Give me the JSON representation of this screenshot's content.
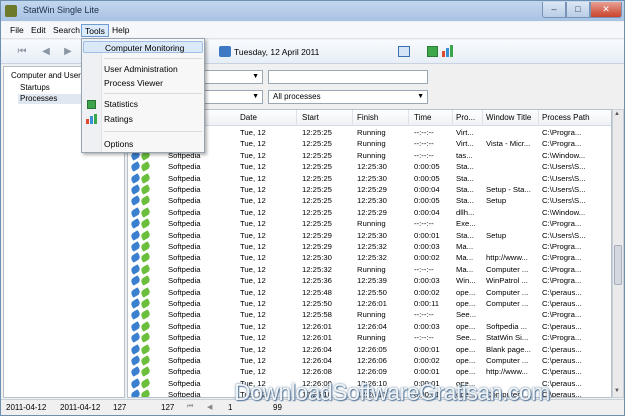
{
  "window": {
    "title": "StatWin Single Lite"
  },
  "menubar": {
    "items": [
      "File",
      "Edit",
      "Search",
      "Tools",
      "Help"
    ]
  },
  "toolbar": {
    "date": "Tuesday, 12 April 2011"
  },
  "tools_menu": {
    "items": [
      "Computer Monitoring",
      "User Administration",
      "Process Viewer",
      "Statistics",
      "Ratings",
      "Options"
    ]
  },
  "tree": {
    "items": [
      "Computer and Users",
      "Startups",
      "Processes"
    ]
  },
  "filters": {
    "process_filter": "All processes"
  },
  "grid": {
    "columns": [
      "Date",
      "Start",
      "Finish",
      "Time",
      "Pro...",
      "Window Title",
      "Process Path"
    ],
    "rows": [
      [
        "",
        "Tue, 12",
        "12:25:25",
        "Running",
        "--:--:--",
        "Virt...",
        "",
        "C:\\Progra..."
      ],
      [
        "",
        "Tue, 12",
        "12:25:25",
        "Running",
        "--:--:--",
        "Virt...",
        "Vista - Micr...",
        "C:\\Progra..."
      ],
      [
        "Softpedia",
        "Tue, 12",
        "12:25:25",
        "Running",
        "--:--:--",
        "tas...",
        "",
        "C:\\Window..."
      ],
      [
        "Softpedia",
        "Tue, 12",
        "12:25:25",
        "12:25:30",
        "0:00:05",
        "Sta...",
        "",
        "C:\\Users\\S..."
      ],
      [
        "Softpedia",
        "Tue, 12",
        "12:25:25",
        "12:25:30",
        "0:00:05",
        "Sta...",
        "",
        "C:\\Users\\S..."
      ],
      [
        "Softpedia",
        "Tue, 12",
        "12:25:25",
        "12:25:29",
        "0:00:04",
        "Sta...",
        "Setup - Sta...",
        "C:\\Users\\S..."
      ],
      [
        "Softpedia",
        "Tue, 12",
        "12:25:25",
        "12:25:30",
        "0:00:05",
        "Sta...",
        "Setup",
        "C:\\Users\\S..."
      ],
      [
        "Softpedia",
        "Tue, 12",
        "12:25:25",
        "12:25:29",
        "0:00:04",
        "dllh...",
        "",
        "C:\\Window..."
      ],
      [
        "Softpedia",
        "Tue, 12",
        "12:25:25",
        "Running",
        "--:--:--",
        "Exe...",
        "",
        "C:\\Progra..."
      ],
      [
        "Softpedia",
        "Tue, 12",
        "12:25:29",
        "12:25:30",
        "0:00:01",
        "Sta...",
        "Setup",
        "C:\\Users\\S..."
      ],
      [
        "Softpedia",
        "Tue, 12",
        "12:25:29",
        "12:25:32",
        "0:00:03",
        "Ma...",
        "",
        "C:\\Progra..."
      ],
      [
        "Softpedia",
        "Tue, 12",
        "12:25:30",
        "12:25:32",
        "0:00:02",
        "Ma...",
        "http://www...",
        "C:\\Progra..."
      ],
      [
        "Softpedia",
        "Tue, 12",
        "12:25:32",
        "Running",
        "--:--:--",
        "Ma...",
        "Computer ...",
        "C:\\Progra..."
      ],
      [
        "Softpedia",
        "Tue, 12",
        "12:25:36",
        "12:25:39",
        "0:00:03",
        "Win...",
        "WinPatrol ...",
        "C:\\Progra..."
      ],
      [
        "Softpedia",
        "Tue, 12",
        "12:25:48",
        "12:25:50",
        "0:00:02",
        "ope...",
        "Computer ...",
        "C:\\peraus..."
      ],
      [
        "Softpedia",
        "Tue, 12",
        "12:25:50",
        "12:26:01",
        "0:00:11",
        "ope...",
        "Computer ...",
        "C:\\peraus..."
      ],
      [
        "Softpedia",
        "Tue, 12",
        "12:25:58",
        "Running",
        "--:--:--",
        "See...",
        "",
        "C:\\Progra..."
      ],
      [
        "Softpedia",
        "Tue, 12",
        "12:26:01",
        "12:26:04",
        "0:00:03",
        "ope...",
        "Softpedia ...",
        "C:\\peraus..."
      ],
      [
        "Softpedia",
        "Tue, 12",
        "12:26:01",
        "Running",
        "--:--:--",
        "See...",
        "StatWin Si...",
        "C:\\Progra..."
      ],
      [
        "Softpedia",
        "Tue, 12",
        "12:26:04",
        "12:26:05",
        "0:00:01",
        "ope...",
        "Blank page...",
        "C:\\peraus..."
      ],
      [
        "Softpedia",
        "Tue, 12",
        "12:26:04",
        "12:26:06",
        "0:00:02",
        "ope...",
        "Computer ...",
        "C:\\peraus..."
      ],
      [
        "Softpedia",
        "Tue, 12",
        "12:26:08",
        "12:26:09",
        "0:00:01",
        "ope...",
        "http://www...",
        "C:\\peraus..."
      ],
      [
        "Softpedia",
        "Tue, 12",
        "12:26:09",
        "12:26:10",
        "0:00:01",
        "ope...",
        "",
        "C:\\peraus..."
      ],
      [
        "Softpedia",
        "Tue, 12",
        "12:26:10",
        "12:26:11",
        "0:00:01",
        "ope...",
        "Computer ...",
        "C:\\peraus..."
      ]
    ]
  },
  "statusbar": {
    "date_from": "2011-04-12",
    "date_to": "2011-04-12",
    "count1": "127",
    "count2": "127",
    "page": "1",
    "page_count": "99"
  },
  "watermark": {
    "text": "DownloadSoftwareGratisan.com"
  }
}
